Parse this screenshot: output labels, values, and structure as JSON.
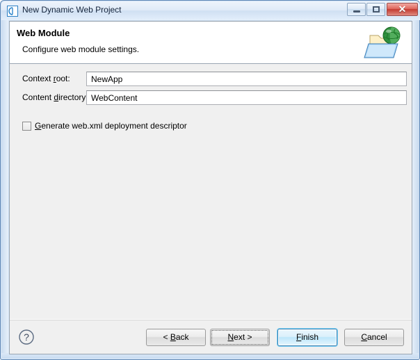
{
  "window": {
    "title": "New Dynamic Web Project",
    "app_icon": "eclipse-project-icon",
    "minimize_label": "Minimize",
    "maximize_label": "Maximize",
    "close_label": "✕"
  },
  "header": {
    "title": "Web Module",
    "description": "Configure web module settings.",
    "icon": "web-folder-globe-icon"
  },
  "form": {
    "context_root": {
      "label_pre": "Context ",
      "label_mnemonic": "r",
      "label_post": "oot:",
      "value": "NewApp",
      "placeholder": ""
    },
    "content_directory": {
      "label_pre": "Content ",
      "label_mnemonic": "d",
      "label_post": "irectory:",
      "value": "WebContent",
      "placeholder": ""
    },
    "generate_webxml": {
      "label_pre": "",
      "label_mnemonic": "G",
      "label_post": "enerate web.xml deployment descriptor",
      "checked": false
    }
  },
  "buttons": {
    "help": "?",
    "back": {
      "pre": "< ",
      "mnemonic": "B",
      "post": "ack"
    },
    "next": {
      "pre": "",
      "mnemonic": "N",
      "post": "ext >"
    },
    "finish": {
      "pre": "",
      "mnemonic": "F",
      "post": "inish"
    },
    "cancel": {
      "pre": "",
      "mnemonic": "C",
      "post": "ancel"
    }
  },
  "colors": {
    "dialog_bg": "#f0f0f0",
    "header_bg": "#ffffff",
    "frame_accent": "#5e86b5",
    "default_button_border": "#3c7fb1",
    "close_button": "#c33a30"
  }
}
